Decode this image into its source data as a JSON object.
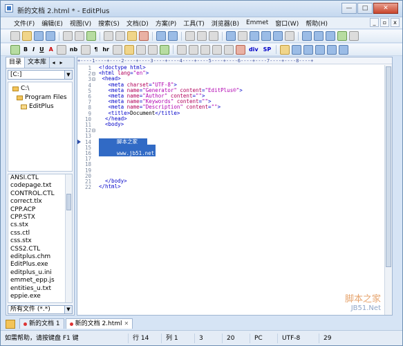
{
  "window": {
    "title": "新的文档 2.html * - EditPlus",
    "minimize": "—",
    "maximize": "□",
    "close": "✕"
  },
  "menu": [
    "文件(F)",
    "编辑(E)",
    "视图(V)",
    "搜索(S)",
    "文档(D)",
    "方案(P)",
    "工具(T)",
    "浏览器(B)",
    "Emmet",
    "窗口(W)",
    "帮助(H)"
  ],
  "toolbar2_text": [
    "B",
    "I",
    "U",
    "A",
    "nb",
    "¶",
    "hr",
    "div",
    "SP"
  ],
  "sidebar": {
    "tabs": [
      "目录",
      "文本库"
    ],
    "drive": "[C:]",
    "tree": [
      "C:\\",
      "Program Files",
      "EditPlus"
    ],
    "files": [
      "ANSI.CTL",
      "codepage.txt",
      "CONTROL.CTL",
      "correct.tlx",
      "CPP.ACP",
      "CPP.STX",
      "cs.stx",
      "css.ctl",
      "css.stx",
      "CSS2.CTL",
      "editplus.chm",
      "EditPlus.exe",
      "editplus_u.ini",
      "emmet_epp.js",
      "entities_u.txt",
      "eppie.exe"
    ],
    "filter": "所有文件 (*.*)"
  },
  "editor": {
    "ruler": "+----1----+----2----+----3----+----4----+----5----+----6----+----7----+----8----+",
    "line_numbers": [
      "1",
      "2",
      "3",
      "4",
      "5",
      "6",
      "7",
      "8",
      "9",
      "10",
      "11",
      "12",
      "13",
      "14",
      "15",
      "16",
      "17",
      "18",
      "19",
      "20",
      "21",
      "22"
    ],
    "selected_lines": [
      "脚本之家",
      "",
      "www.jb51.net"
    ],
    "watermark_1": "脚本之家",
    "watermark_2": "JB51.Net"
  },
  "doc_tabs": [
    "新的文档 1",
    "新的文档 2.html"
  ],
  "status": {
    "hint": "如需帮助，请按键盘 F1 键",
    "row": "行 14",
    "col": "列 1",
    "v1": "3",
    "v2": "20",
    "mode": "PC",
    "encoding": "UTF-8",
    "end": "29"
  }
}
